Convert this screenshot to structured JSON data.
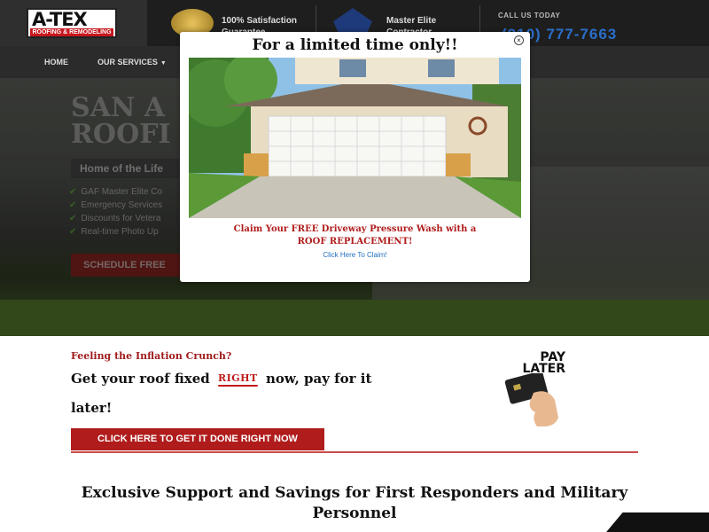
{
  "header": {
    "logo_text": "A-TEX",
    "logo_subtext": "ROOFING & REMODELING",
    "badges": [
      {
        "text": "100% Satisfaction Guarantee",
        "icon": "gold-seal-icon"
      },
      {
        "text": "Master Elite Contractor",
        "icon": "gaf-shield-icon"
      }
    ],
    "call_label": "CALL US TODAY",
    "phone": "(210) 777-7663"
  },
  "nav": {
    "items": [
      {
        "label": "HOME"
      },
      {
        "label": "OUR SERVICES",
        "has_dropdown": true
      }
    ]
  },
  "hero": {
    "title_line1": "SAN A",
    "title_line2": "ROOFI",
    "tagline": "Home of the Life",
    "features": [
      "GAF Master Elite Co",
      "Emergency Services",
      "Discounts for Vetera",
      "Real-time Photo Up"
    ],
    "cta_label": "SCHEDULE FREE"
  },
  "modal": {
    "title": "For a limited time only!!",
    "offer_line1": "Claim Your FREE Driveway Pressure Wash with a",
    "offer_line2": "ROOF REPLACEMENT!",
    "link_label": "Click Here To Claim!",
    "close_label": "×"
  },
  "promo": {
    "eyebrow": "Feeling the Inflation Crunch?",
    "line1_before": "Get your roof fixed",
    "line1_highlight": "RIGHT",
    "line1_after": "now, pay for it",
    "line2": "later!",
    "cta_label": "CLICK HERE TO GET IT DONE RIGHT NOW",
    "pay_later_line1": "PAY",
    "pay_later_line2": "LATER"
  },
  "section": {
    "heading": "Exclusive Support and Savings for First Responders and Military Personnel"
  },
  "colors": {
    "brand_red": "#b01c1c",
    "link_blue": "#1f6fc2",
    "header_dark": "#1e1e1e"
  }
}
